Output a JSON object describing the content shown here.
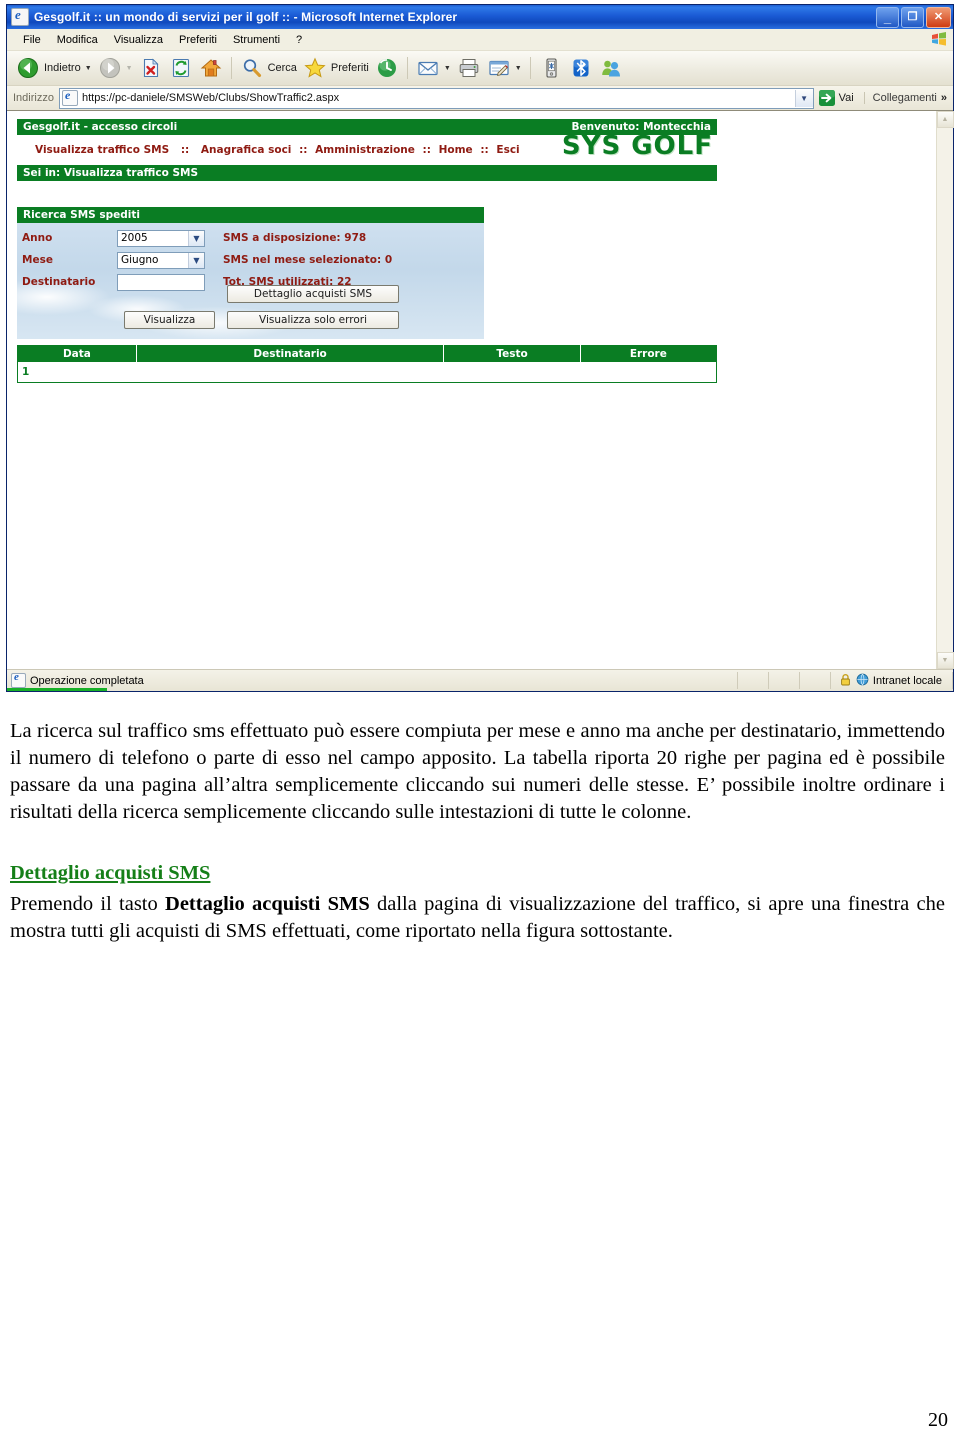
{
  "browser": {
    "title": "Gesgolf.it :: un mondo di servizi per il golf :: - Microsoft Internet Explorer",
    "title_icon": "ie-document-icon",
    "window_buttons": {
      "minimize": "_",
      "restore": "❐",
      "close": "✕"
    },
    "menu": [
      {
        "label": "File"
      },
      {
        "label": "Modifica"
      },
      {
        "label": "Visualizza"
      },
      {
        "label": "Preferiti"
      },
      {
        "label": "Strumenti"
      },
      {
        "label": "?"
      }
    ],
    "toolbar": {
      "back_label": "Indietro",
      "forward_label": "",
      "search_label": "Cerca",
      "favorites_label": "Preferiti",
      "icons": [
        "back-arrow-icon",
        "forward-arrow-icon",
        "stop-icon",
        "refresh-icon",
        "home-icon",
        "search-icon",
        "favorites-star-icon",
        "history-icon",
        "mail-icon",
        "print-icon",
        "edit-icon",
        "pda-icon",
        "bluetooth-icon",
        "messenger-icon"
      ]
    },
    "address": {
      "label": "Indirizzo",
      "url": "https://pc-daniele/SMSWeb/Clubs/ShowTraffic2.aspx",
      "go_label": "Vai",
      "links_label": "Collegamenti",
      "overflow_chevrons": "»"
    },
    "status": {
      "text": "Operazione completata",
      "zone": "Intranet locale",
      "lock_icon": "padlock-icon",
      "globe_icon": "globe-icon"
    },
    "scrollbar": {
      "up": "▲",
      "down": "▼"
    }
  },
  "page": {
    "header": {
      "site_label": "Gesgolf.it - accesso circoli",
      "welcome": "Benvenuto: Montecchia",
      "logo": "SYS GOLF",
      "nav": [
        {
          "label": "Visualizza traffico SMS"
        },
        {
          "label": "Anagrafica soci"
        },
        {
          "label": "Amministrazione"
        },
        {
          "label": "Home"
        },
        {
          "label": "Esci"
        }
      ],
      "nav_separator": "::",
      "breadcrumb": "Sei in: Visualizza traffico SMS"
    },
    "search_panel": {
      "title": "Ricerca SMS spediti",
      "fields": [
        {
          "label": "Anno",
          "type": "select",
          "value": "2005"
        },
        {
          "label": "Mese",
          "type": "select",
          "value": "Giugno"
        },
        {
          "label": "Destinatario",
          "type": "text",
          "value": ""
        }
      ],
      "stats": [
        {
          "text": "SMS a disposizione: 978"
        },
        {
          "text": "SMS nel mese selezionato: 0"
        },
        {
          "text": "Tot. SMS utilizzati: 22"
        }
      ],
      "buttons": {
        "detail": "Dettaglio acquisti SMS",
        "view": "Visualizza",
        "errors_only": "Visualizza solo errori"
      }
    },
    "results": {
      "columns": [
        "Data",
        "Destinatario",
        "Testo",
        "Errore"
      ],
      "rows": [],
      "pager": "1"
    }
  },
  "document": {
    "paragraph1": "La ricerca sul traffico sms effettuato può essere compiuta per mese e anno ma anche per destinatario, immettendo il numero di telefono o parte di esso nel campo apposito. La tabella riporta 20 righe per pagina ed è possibile passare da una pagina all’altra semplicemente cliccando sui numeri delle stesse. E’ possibile inoltre ordinare i risultati della ricerca semplicemente cliccando sulle intestazioni di tutte le colonne.",
    "heading": "Dettaglio acquisti SMS",
    "paragraph2_before": "Premendo il tasto ",
    "paragraph2_bold": "Dettaglio acquisti SMS",
    "paragraph2_after": " dalla pagina di visualizzazione del traffico, si apre una finestra che mostra tutti gli acquisti di SMS effettuati, come riportato nella figura sottostante.",
    "page_number": "20"
  },
  "colors": {
    "green": "#0a7d23",
    "maroon": "#8f1b12",
    "title_blue": "#1a5ad4",
    "heading_green": "#157f18"
  }
}
